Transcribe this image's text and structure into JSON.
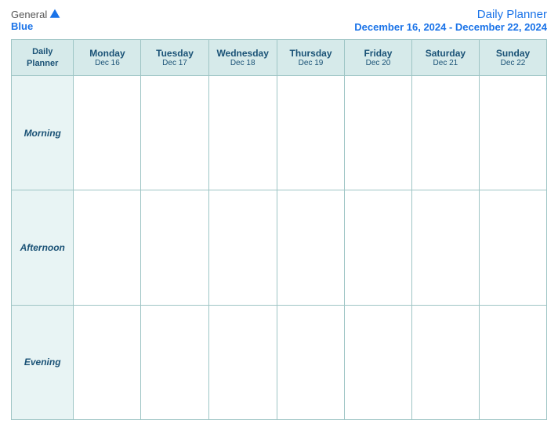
{
  "header": {
    "logo": {
      "general": "General",
      "blue": "Blue",
      "icon_label": "general-blue-logo-icon"
    },
    "title": "Daily Planner",
    "date_range": "December 16, 2024 - December 22, 2024"
  },
  "table": {
    "header_col": {
      "label_line1": "Daily",
      "label_line2": "Planner"
    },
    "columns": [
      {
        "day": "Monday",
        "date": "Dec 16"
      },
      {
        "day": "Tuesday",
        "date": "Dec 17"
      },
      {
        "day": "Wednesday",
        "date": "Dec 18"
      },
      {
        "day": "Thursday",
        "date": "Dec 19"
      },
      {
        "day": "Friday",
        "date": "Dec 20"
      },
      {
        "day": "Saturday",
        "date": "Dec 21"
      },
      {
        "day": "Sunday",
        "date": "Dec 22"
      }
    ],
    "rows": [
      {
        "label": "Morning"
      },
      {
        "label": "Afternoon"
      },
      {
        "label": "Evening"
      }
    ]
  }
}
